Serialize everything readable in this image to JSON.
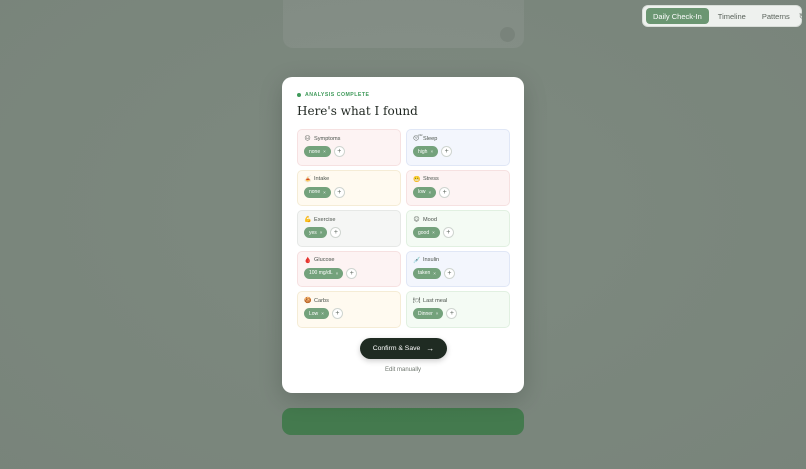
{
  "nav": {
    "tabs": [
      {
        "label": "Daily Check-In",
        "active": true
      },
      {
        "label": "Timeline",
        "active": false
      },
      {
        "label": "Patterns",
        "active": false
      }
    ],
    "refresh_glyph": "↻"
  },
  "modal": {
    "status": "ANALYSIS COMPLETE",
    "title": "Here's what I found",
    "categories": [
      {
        "icon": "😐",
        "label": "Symptoms",
        "chip": "none",
        "tint": "pink"
      },
      {
        "icon": "😴",
        "label": "Sleep",
        "chip": "high",
        "tint": "blue"
      },
      {
        "icon": "🍝",
        "label": "Intake",
        "chip": "none",
        "tint": "yellow"
      },
      {
        "icon": "😬",
        "label": "Stress",
        "chip": "low",
        "tint": "pink"
      },
      {
        "icon": "💪",
        "label": "Exercise",
        "chip": "yes",
        "tint": "gray"
      },
      {
        "icon": "😊",
        "label": "Mood",
        "chip": "good",
        "tint": "green"
      },
      {
        "icon": "🩸",
        "label": "Glucose",
        "chip": "100 mg/dL",
        "tint": "pink"
      },
      {
        "icon": "💉",
        "label": "Insulin",
        "chip": "taken",
        "tint": "blue"
      },
      {
        "icon": "🍪",
        "label": "Carbs",
        "chip": "Low",
        "tint": "yellow"
      },
      {
        "icon": "🍽",
        "label": "Last meal",
        "chip": "Dinner",
        "tint": "green"
      }
    ],
    "chip_remove": "×",
    "add": "+",
    "confirm_label": "Confirm & Save",
    "confirm_arrow": "→",
    "edit_label": "Edit manually"
  },
  "colors": {
    "accent": "#74a27c",
    "status": "#3f9a5a",
    "primary_button": "#1f2b22"
  }
}
